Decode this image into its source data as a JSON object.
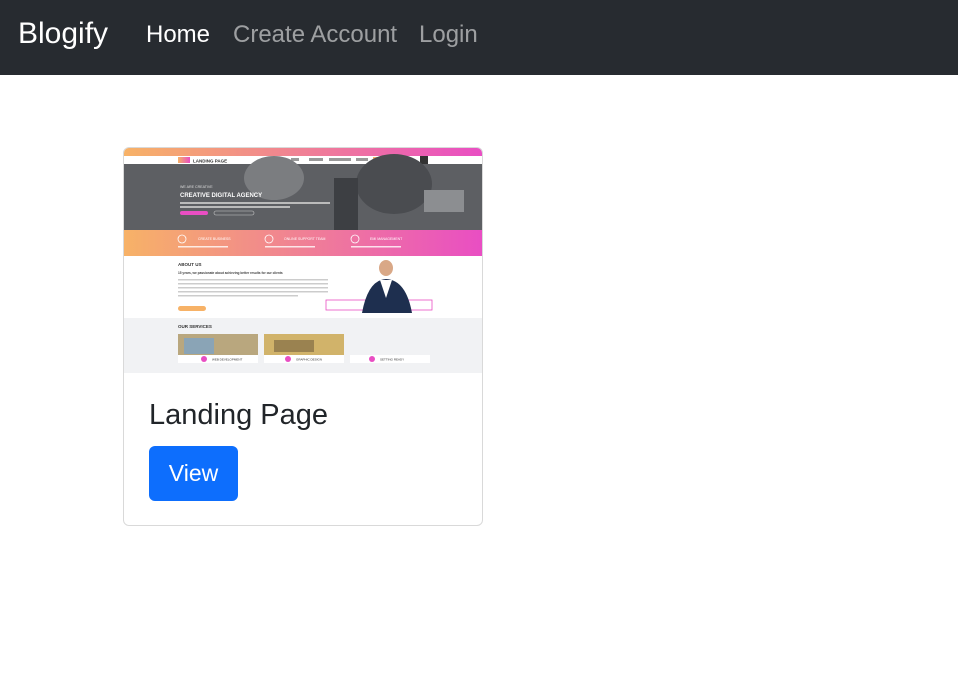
{
  "navbar": {
    "brand": "Blogify",
    "links": [
      "Home",
      "Create Account",
      "Login"
    ]
  },
  "card": {
    "title": "Landing Page",
    "button_label": "View",
    "thumbnail": {
      "logo_text": "LANDING PAGE",
      "hero_tagline": "WE ARE CREATIVE",
      "hero_title": "CREATIVE DIGITAL AGENCY",
      "features": [
        "CREATE BUSINESS",
        "ONLINE SUPPORT TEAM",
        "EMI MANAGEMENT"
      ],
      "about_heading": "ABOUT US",
      "about_text": "15 years, we passionate about achieving better results for our clients",
      "services_heading": "OUR SERVICES",
      "service_labels": [
        "WEB DEVELOPMENT",
        "GRAPHIC DESIGN",
        "SETTING READY"
      ]
    }
  },
  "colors": {
    "navbar_bg": "#272b30",
    "primary": "#0d6efd",
    "gradient_start": "#f7b267",
    "gradient_end": "#e94ec3"
  }
}
